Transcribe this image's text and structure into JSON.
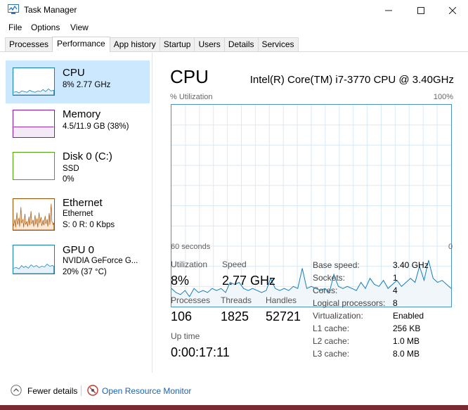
{
  "window": {
    "title": "Task Manager",
    "icon": "task-manager-icon"
  },
  "menu": [
    "File",
    "Options",
    "View"
  ],
  "tabs": [
    {
      "label": "Processes",
      "active": false
    },
    {
      "label": "Performance",
      "active": true
    },
    {
      "label": "App history",
      "active": false
    },
    {
      "label": "Startup",
      "active": false
    },
    {
      "label": "Users",
      "active": false
    },
    {
      "label": "Details",
      "active": false
    },
    {
      "label": "Services",
      "active": false
    }
  ],
  "resources": [
    {
      "name": "CPU",
      "sub1": "8% 2.77 GHz",
      "sub2": "",
      "selected": true,
      "color": "#117dbb"
    },
    {
      "name": "Memory",
      "sub1": "4.5/11.9 GB (38%)",
      "sub2": "",
      "selected": false,
      "color": "#8b12ae",
      "level": 0.38
    },
    {
      "name": "Disk 0 (C:)",
      "sub1": "SSD",
      "sub2": "0%",
      "selected": false,
      "color": "#4da60c"
    },
    {
      "name": "Ethernet",
      "sub1": "Ethernet",
      "sub2": "S: 0 R: 0 Kbps",
      "selected": false,
      "color": "#a74f01"
    },
    {
      "name": "GPU 0",
      "sub1": "NVIDIA GeForce G...",
      "sub2": "20% (37 °C)",
      "selected": false,
      "color": "#117dbb"
    }
  ],
  "detail": {
    "title": "CPU",
    "model": "Intel(R) Core(TM) i7-3770 CPU @ 3.40GHz",
    "y_label": "% Utilization",
    "y_max": "100%",
    "x_left": "60 seconds",
    "x_right": "0",
    "utilization_pct": [
      9,
      7,
      6,
      8,
      5,
      9,
      7,
      8,
      7,
      9,
      8,
      9,
      7,
      12,
      11,
      12,
      9,
      8,
      9,
      8,
      7,
      8,
      14,
      9,
      8,
      9,
      8,
      10,
      9,
      19,
      9,
      10,
      9,
      8,
      9,
      7,
      16,
      10,
      9,
      10,
      9,
      8,
      12,
      9,
      14,
      11,
      10,
      13,
      9,
      11,
      13,
      10,
      12,
      14,
      12,
      20,
      13,
      23,
      14,
      12,
      13,
      11,
      9
    ]
  },
  "stats": {
    "utilization_label": "Utilization",
    "utilization_value": "8%",
    "speed_label": "Speed",
    "speed_value": "2.77 GHz",
    "processes_label": "Processes",
    "processes_value": "106",
    "threads_label": "Threads",
    "threads_value": "1825",
    "handles_label": "Handles",
    "handles_value": "52721",
    "uptime_label": "Up time",
    "uptime_value": "0:00:17:11"
  },
  "specs": [
    {
      "label": "Base speed:",
      "value": "3.40 GHz"
    },
    {
      "label": "Sockets:",
      "value": "1"
    },
    {
      "label": "Cores:",
      "value": "4"
    },
    {
      "label": "Logical processors:",
      "value": "8"
    },
    {
      "label": "Virtualization:",
      "value": "Enabled"
    },
    {
      "label": "L1 cache:",
      "value": "256 KB"
    },
    {
      "label": "L2 cache:",
      "value": "1.0 MB"
    },
    {
      "label": "L3 cache:",
      "value": "8.0 MB"
    }
  ],
  "footer": {
    "fewer_details": "Fewer details",
    "resource_monitor": "Open Resource Monitor"
  }
}
